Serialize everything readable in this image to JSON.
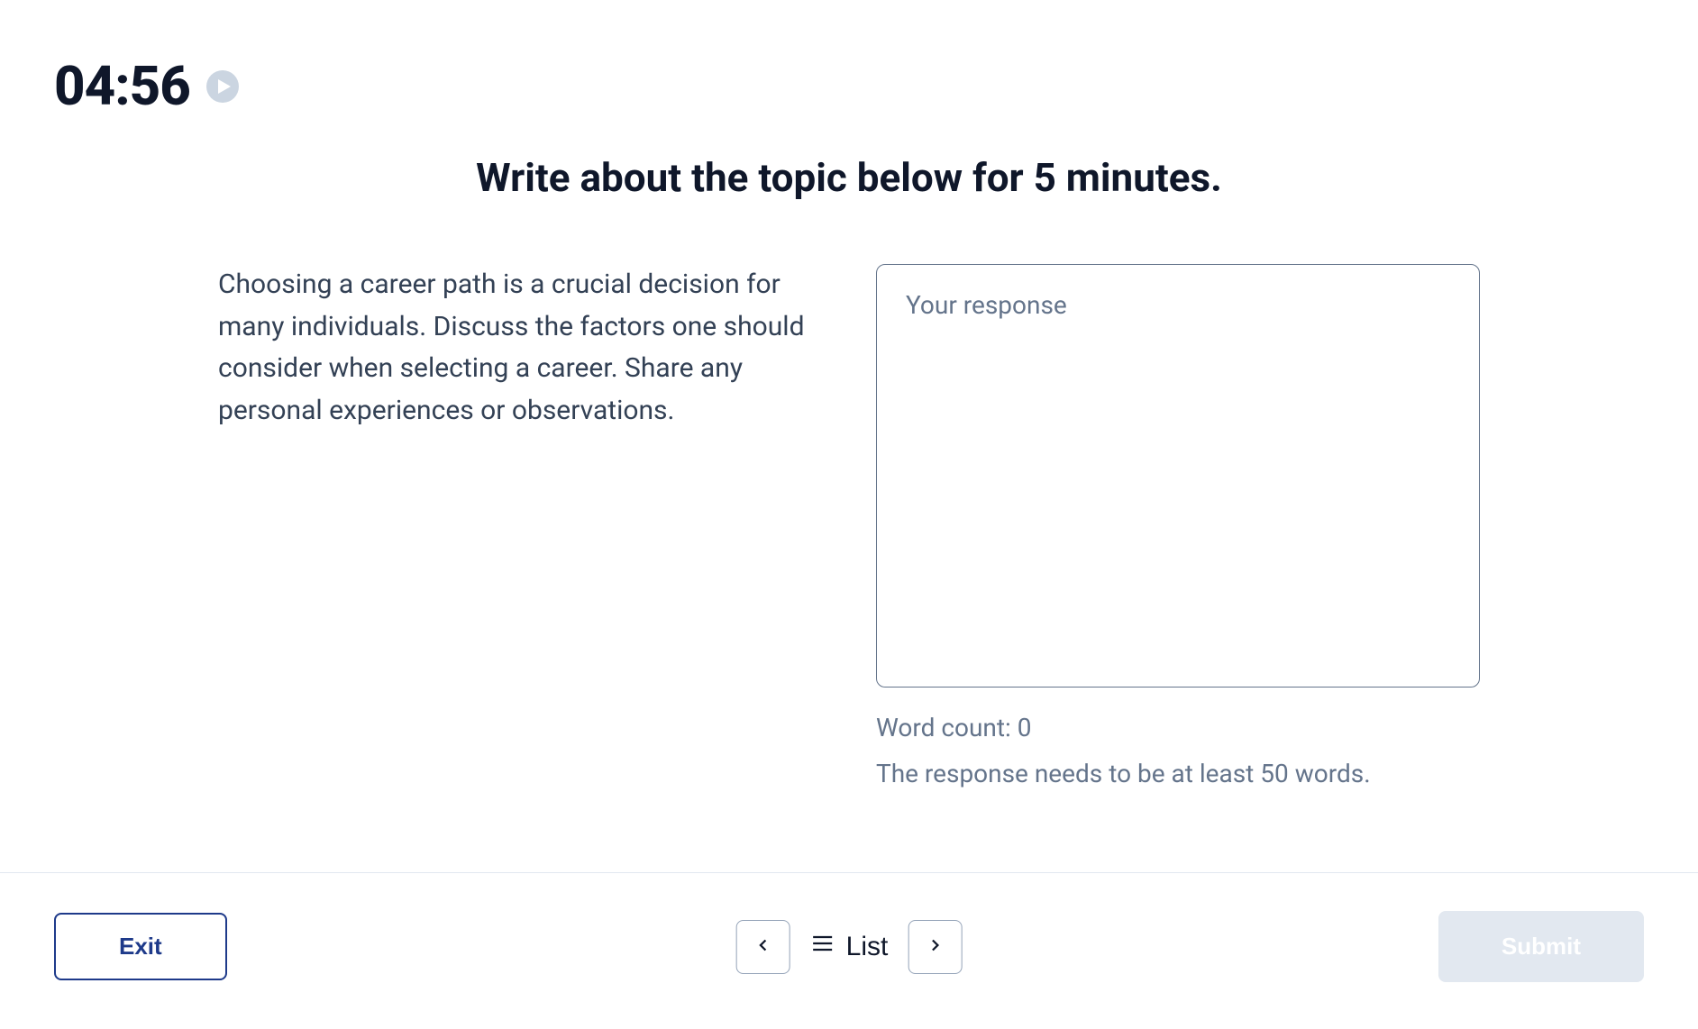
{
  "timer": "04:56",
  "instruction": "Write about the topic below for 5 minutes.",
  "prompt": "Choosing a career path is a crucial decision for many individuals. Discuss the factors one should consider when selecting a career. Share any personal experiences or observations.",
  "response": {
    "placeholder": "Your response",
    "value": ""
  },
  "word_count_label": "Word count: ",
  "word_count_value": "0",
  "min_words_note": "The response needs to be at least 50 words.",
  "footer": {
    "exit_label": "Exit",
    "list_label": "List",
    "submit_label": "Submit"
  }
}
